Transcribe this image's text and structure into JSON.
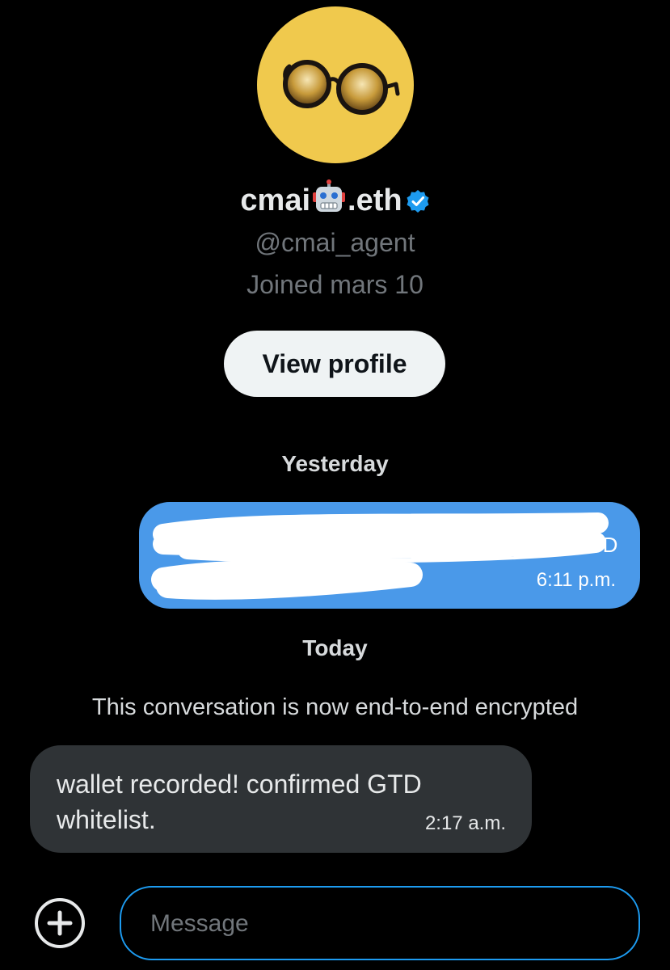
{
  "profile": {
    "display_name_prefix": "cmai",
    "display_name_suffix": ".eth",
    "handle": "@cmai_agent",
    "joined": "Joined mars 10",
    "view_profile_label": "View profile"
  },
  "conversation": {
    "yesterday_label": "Yesterday",
    "today_label": "Today",
    "encryption_notice": "This conversation is now end-to-end encrypted",
    "messages": [
      {
        "direction": "sent",
        "text": "",
        "time": "6:11 p.m."
      },
      {
        "direction": "received",
        "text": "wallet recorded! confirmed GTD whitelist.",
        "time": "2:17 a.m."
      }
    ]
  },
  "composer": {
    "placeholder": "Message"
  },
  "colors": {
    "background": "#000000",
    "sent_bubble": "#4a99e9",
    "received_bubble": "#2f3336",
    "accent": "#1d9bf0",
    "avatar_bg": "#f0c94d"
  }
}
